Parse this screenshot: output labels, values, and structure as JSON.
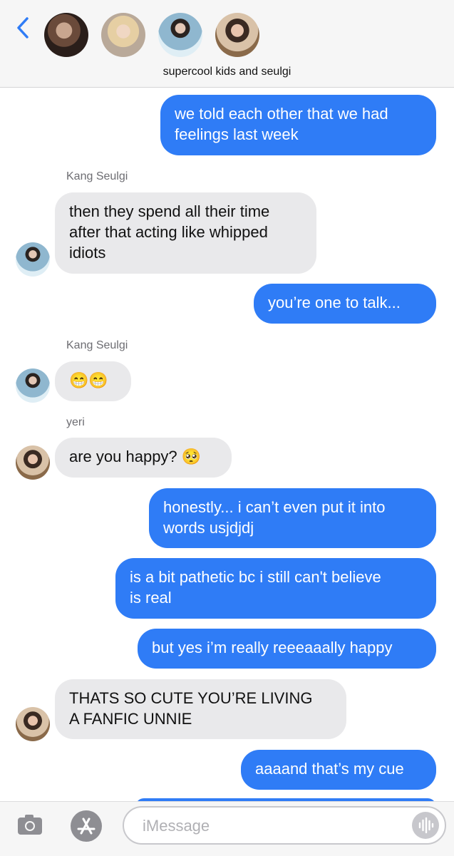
{
  "header": {
    "group_name": "supercool kids and seulgi"
  },
  "messages": [
    {
      "direction": "outgoing",
      "text": "we told each other that we had\nfeelings last week"
    },
    {
      "direction": "incoming",
      "sender": "Kang Seulgi",
      "text": "then they spend all their time\nafter that acting like whipped\nidiots"
    },
    {
      "direction": "outgoing",
      "text": "you’re one to talk..."
    },
    {
      "direction": "incoming",
      "sender": "Kang Seulgi",
      "text": "😁😁"
    },
    {
      "direction": "incoming",
      "sender": "yeri",
      "text": "are you happy? 🥺"
    },
    {
      "direction": "outgoing",
      "text": "honestly... i can’t even put it into\nwords usjdjdj"
    },
    {
      "direction": "outgoing",
      "text": "is a bit pathetic bc i still can't believe\nis real"
    },
    {
      "direction": "outgoing",
      "text": "but yes i’m really reeeaaally happy"
    },
    {
      "direction": "incoming",
      "text": "THATS SO CUTE YOU’RE LIVING\nA FANFIC UNNIE"
    },
    {
      "direction": "outgoing",
      "text": "aaaand that’s my cue"
    }
  ],
  "composer": {
    "placeholder": "iMessage"
  },
  "icons": {
    "back": "chevron-left-icon",
    "camera": "camera-icon",
    "apps": "app-store-icon",
    "audio": "audio-waveform-icon"
  },
  "colors": {
    "outgoing_bubble": "#2f7cf6",
    "incoming_bubble": "#e9e9eb",
    "accent": "#2f7cf6"
  }
}
